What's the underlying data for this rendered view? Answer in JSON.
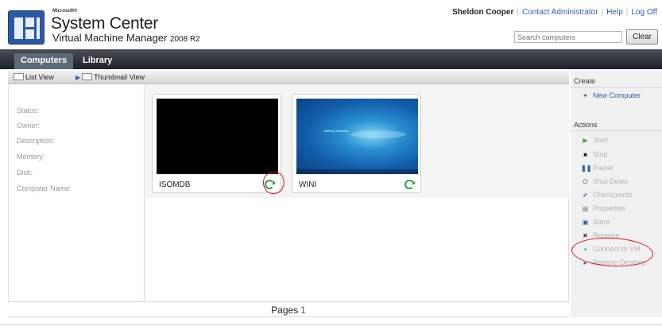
{
  "header": {
    "brand_small": "Microsoft®",
    "brand_title": "System Center",
    "brand_subtitle": "Virtual Machine Manager",
    "brand_version": "2008 R2",
    "user_name": "Sheldon Cooper",
    "links": [
      "Contact Administrator",
      "Help",
      "Log Off"
    ],
    "search_placeholder": "Search computers",
    "clear_label": "Clear"
  },
  "nav": {
    "tabs": [
      "Computers",
      "Library"
    ],
    "active": "Computers"
  },
  "toolbar": {
    "list_view": "List View",
    "thumbnail_view": "Thumbnail View"
  },
  "details": {
    "labels": [
      "Status:",
      "Owner:",
      "Description:",
      "Memory:",
      "Disk:",
      "Computer Name:"
    ]
  },
  "vms": [
    {
      "name": "ISOMDB",
      "screen": "black",
      "status": "running"
    },
    {
      "name": "WINI",
      "screen": "windows-7-desktop",
      "status": "running",
      "screen_text": "Starting Windows"
    }
  ],
  "pager": {
    "label": "Pages",
    "current": "1"
  },
  "actions_panel": {
    "create_heading": "Create",
    "create_items": [
      {
        "label": "New Computer",
        "icon": "new-computer-icon"
      }
    ],
    "actions_heading": "Actions",
    "action_items": [
      {
        "label": "Start",
        "icon": "play-icon"
      },
      {
        "label": "Stop",
        "icon": "stop-icon"
      },
      {
        "label": "Pause",
        "icon": "pause-icon"
      },
      {
        "label": "Shut Down",
        "icon": "shutdown-icon"
      },
      {
        "label": "Checkpoints",
        "icon": "checkmark-icon"
      },
      {
        "label": "Properties",
        "icon": "properties-icon"
      },
      {
        "label": "Store",
        "icon": "store-icon"
      },
      {
        "label": "Remove",
        "icon": "remove-icon"
      },
      {
        "label": "Connect to VM",
        "icon": "connect-icon"
      },
      {
        "label": "Remote Desktop",
        "icon": "remote-desktop-icon"
      }
    ]
  },
  "colors": {
    "link": "#2f5fa8",
    "annotation": "#d9141e",
    "status_ok": "#2e9e3a"
  }
}
